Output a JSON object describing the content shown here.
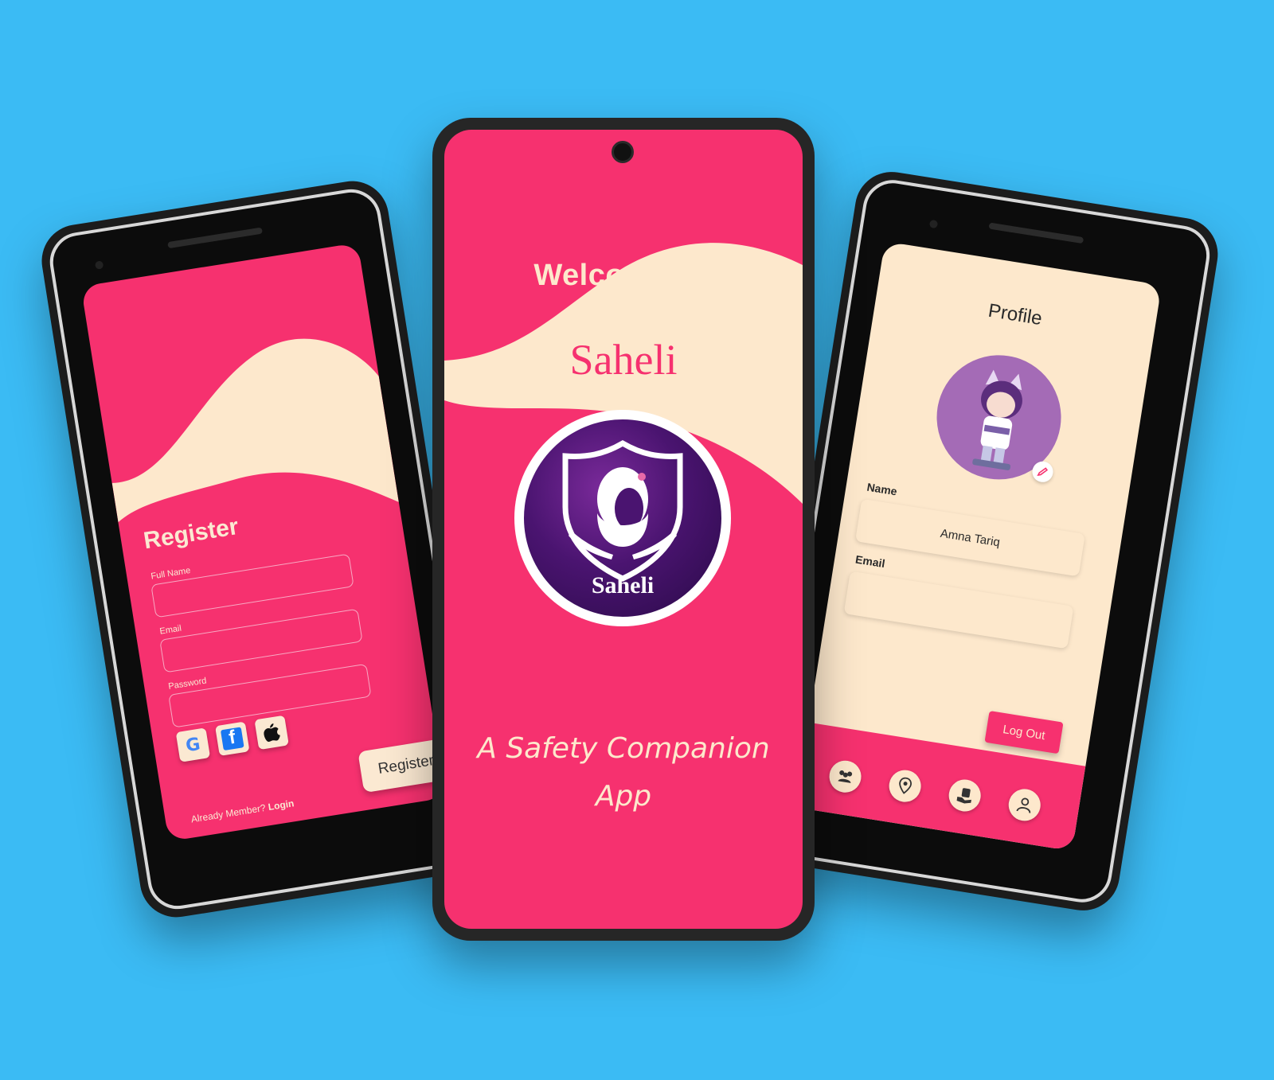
{
  "background_color": "#3bbbf4",
  "colors": {
    "pink": "#f6316f",
    "cream": "#fde8cc",
    "purple": "#4a1470"
  },
  "register_screen": {
    "title": "Register",
    "fields": [
      {
        "label": "Full Name",
        "value": ""
      },
      {
        "label": "Email",
        "value": ""
      },
      {
        "label": "Password",
        "value": ""
      }
    ],
    "social_buttons": [
      {
        "icon": "google-icon",
        "glyph": "G"
      },
      {
        "icon": "facebook-icon",
        "glyph": "f"
      },
      {
        "icon": "apple-icon",
        "glyph": ""
      }
    ],
    "register_button": "Register",
    "already_member_text": "Already Member?",
    "login_link": "Login"
  },
  "welcome_screen": {
    "heading": "Welcome To",
    "app_name": "Saheli",
    "logo_text": "Saheli",
    "tagline_line1": "A Safety Companion",
    "tagline_line2": "App"
  },
  "profile_screen": {
    "title": "Profile",
    "name_label": "Name",
    "name_value": "Amna Tariq",
    "email_label": "Email",
    "email_value": "",
    "logout_button": "Log Out",
    "nav_items": [
      "community-icon",
      "location-icon",
      "helpline-icon",
      "user-icon"
    ]
  }
}
